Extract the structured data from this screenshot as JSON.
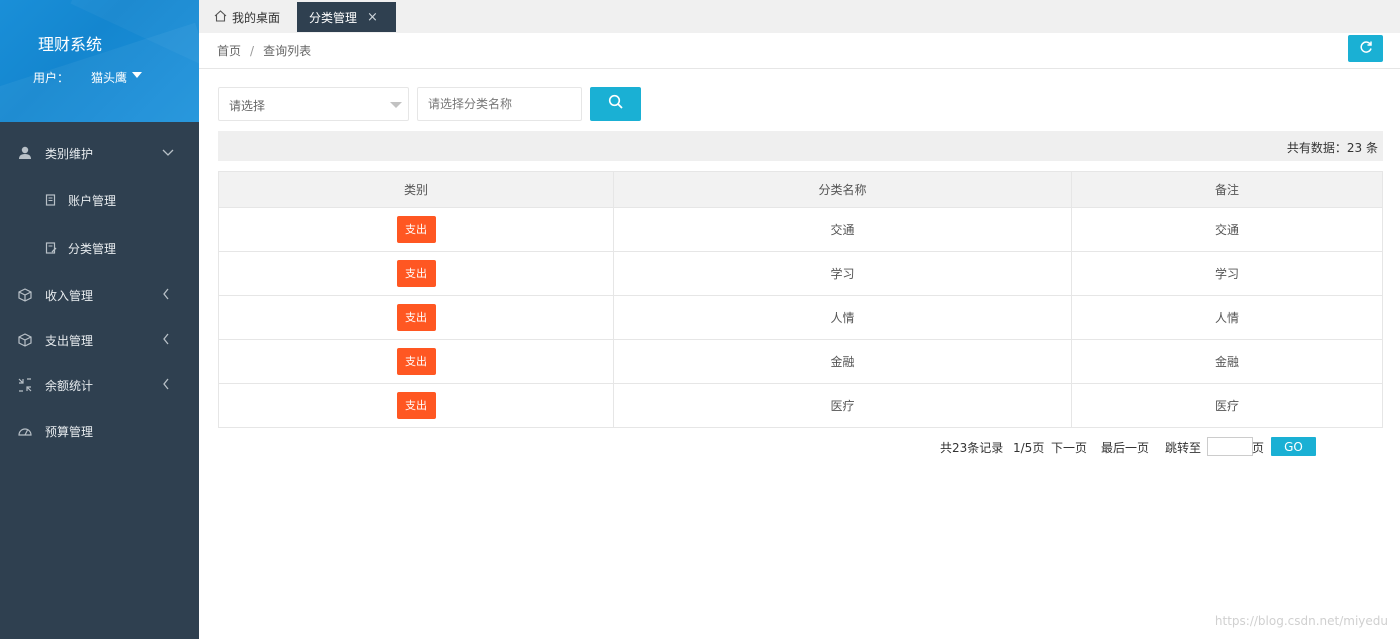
{
  "app": {
    "title": "理财系统"
  },
  "user": {
    "label": "用户：",
    "name": "猫头鹰"
  },
  "sidebar": {
    "items": [
      {
        "label": "类别维护",
        "icon": "user-icon",
        "arrow": "﹀"
      },
      {
        "label": "账户管理",
        "icon": "doc-icon"
      },
      {
        "label": "分类管理",
        "icon": "doc-edit-icon"
      },
      {
        "label": "收入管理",
        "icon": "cube-icon",
        "arrow": "‹"
      },
      {
        "label": "支出管理",
        "icon": "cube-icon",
        "arrow": "‹"
      },
      {
        "label": "余额统计",
        "icon": "shrink-icon",
        "arrow": "‹"
      },
      {
        "label": "预算管理",
        "icon": "gauge-icon"
      }
    ]
  },
  "tabs": {
    "home": "我的桌面",
    "active": "分类管理",
    "close": "×"
  },
  "breadcrumb": {
    "home": "首页",
    "sep": "/",
    "current": "查询列表"
  },
  "search": {
    "select_value": "请选择",
    "input_placeholder": "请选择分类名称"
  },
  "count": {
    "text": "共有数据：23 条"
  },
  "table": {
    "headers": [
      "类别",
      "分类名称",
      "备注"
    ],
    "rows": [
      {
        "type": "支出",
        "name": "交通",
        "note": "交通"
      },
      {
        "type": "支出",
        "name": "学习",
        "note": "学习"
      },
      {
        "type": "支出",
        "name": "人情",
        "note": "人情"
      },
      {
        "type": "支出",
        "name": "金融",
        "note": "金融"
      },
      {
        "type": "支出",
        "name": "医疗",
        "note": "医疗"
      }
    ]
  },
  "pager": {
    "total": "共23条记录",
    "page": "1/5页",
    "next": "下一页",
    "last": "最后一页",
    "jump": "跳转至",
    "page_unit": "页",
    "go": "GO"
  },
  "watermark": "https://blog.csdn.net/miyedu",
  "colors": {
    "sidebar": "#2f4050",
    "header": "#1a8fd8",
    "accent": "#1ab0d4",
    "tag": "#ff5722"
  }
}
